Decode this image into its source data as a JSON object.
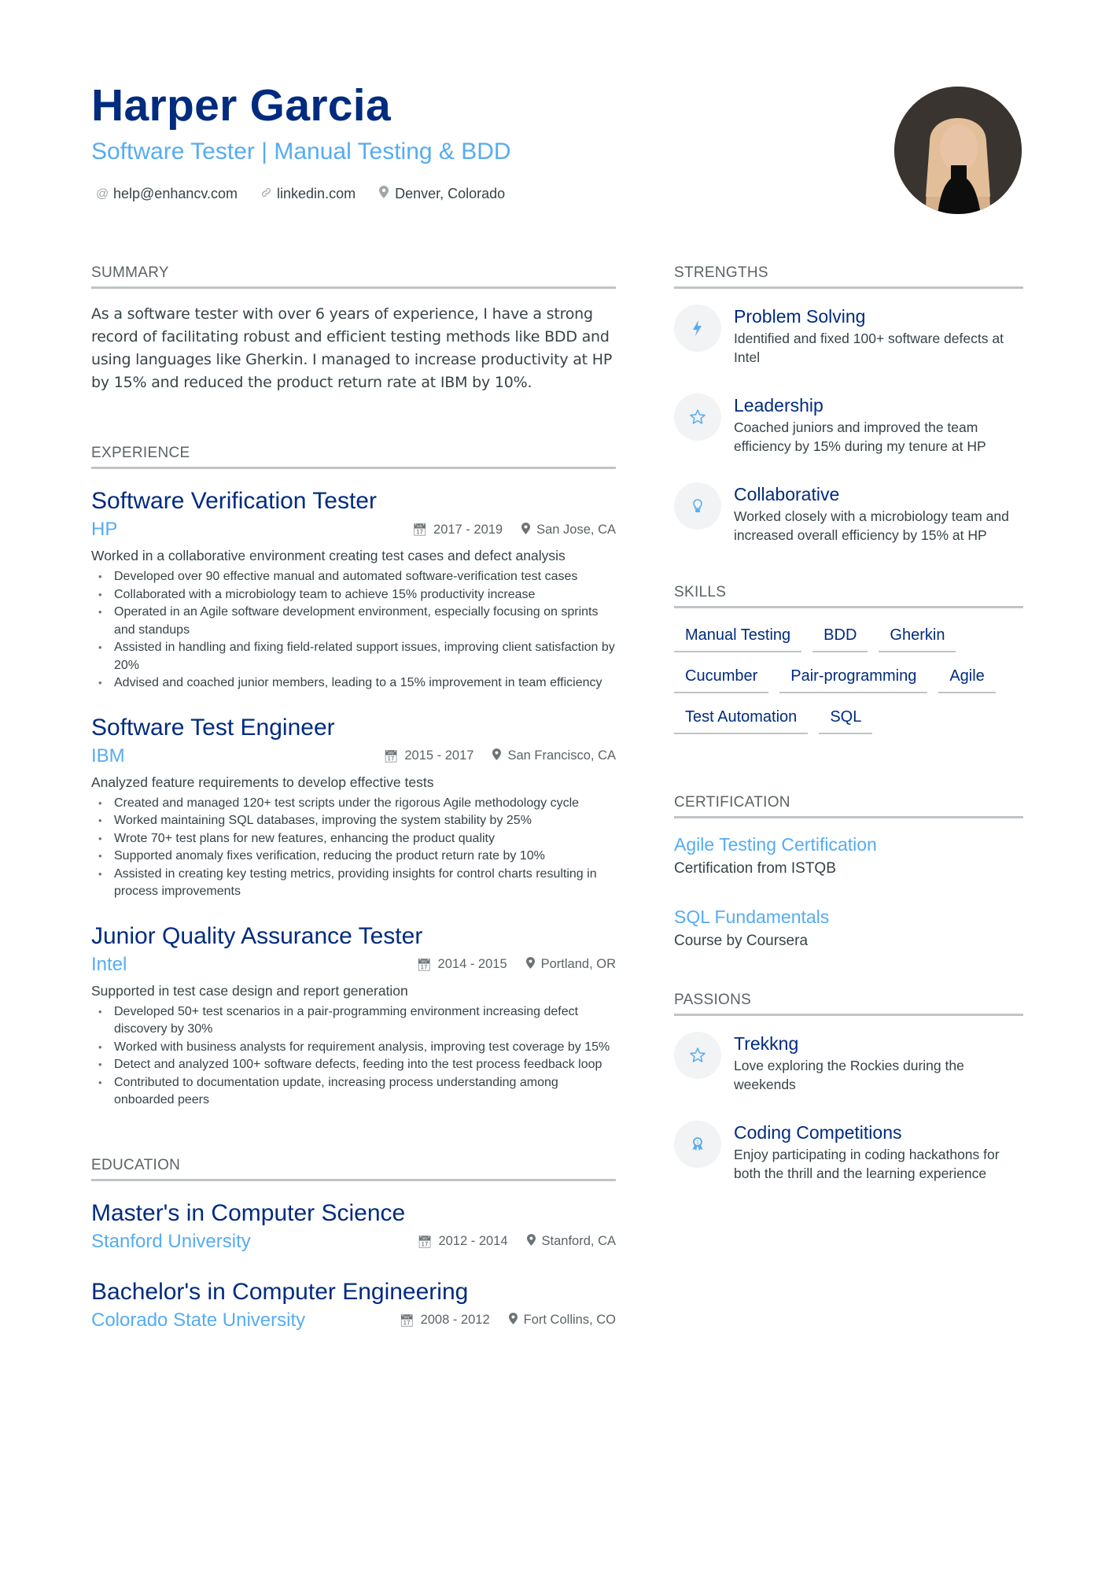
{
  "header": {
    "name": "Harper Garcia",
    "title": "Software Tester | Manual Testing & BDD",
    "contacts": [
      {
        "icon": "at-icon",
        "glyph": "@",
        "text": "help@enhancv.com"
      },
      {
        "icon": "link-icon",
        "glyph": "🔗",
        "text": "linkedin.com"
      },
      {
        "icon": "location-pin-icon",
        "glyph": "⚲",
        "text": "Denver, Colorado"
      }
    ]
  },
  "colors": {
    "primary": "#002b7f",
    "accent": "#56acf2",
    "text": "#384347",
    "muted": "#5c6366",
    "divider": "#c0c4c6"
  },
  "summary": {
    "heading": "SUMMARY",
    "text": "As a software tester with over 6 years of experience, I have a strong record of facilitating robust and efficient testing methods like BDD and using languages like Gherkin. I managed to increase productivity at HP by 15% and reduced the product return rate at IBM by 10%."
  },
  "experience": {
    "heading": "EXPERIENCE",
    "items": [
      {
        "title": "Software Verification Tester",
        "company": "HP",
        "dates": "2017 - 2019",
        "location": "San Jose, CA",
        "description": "Worked in a collaborative environment creating test cases and defect analysis",
        "bullets": [
          "Developed over 90 effective manual and automated software-verification test cases",
          "Collaborated with a microbiology team to achieve 15% productivity increase",
          "Operated in an Agile software development environment, especially focusing on sprints and standups",
          "Assisted in handling and fixing field-related support issues, improving client satisfaction by 20%",
          "Advised and coached junior members, leading to a 15% improvement in team efficiency"
        ]
      },
      {
        "title": "Software Test Engineer",
        "company": "IBM",
        "dates": "2015 - 2017",
        "location": "San Francisco, CA",
        "description": "Analyzed feature requirements to develop effective tests",
        "bullets": [
          "Created and managed 120+ test scripts under the rigorous Agile methodology cycle",
          "Worked maintaining SQL databases, improving the system stability by 25%",
          "Wrote 70+ test plans for new features, enhancing the product quality",
          "Supported anomaly fixes verification, reducing the product return rate by 10%",
          "Assisted in creating key testing metrics, providing insights for control charts resulting in process improvements"
        ]
      },
      {
        "title": "Junior Quality Assurance Tester",
        "company": "Intel",
        "dates": "2014 - 2015",
        "location": "Portland, OR",
        "description": "Supported in test case design and report generation",
        "bullets": [
          "Developed 50+ test scenarios in a pair-programming environment increasing defect discovery by 30%",
          "Worked with business analysts for requirement analysis, improving test coverage by 15%",
          "Detect and analyzed 100+ software defects, feeding into the test process feedback loop",
          "Contributed to documentation update, increasing process understanding among onboarded peers"
        ]
      }
    ]
  },
  "education": {
    "heading": "EDUCATION",
    "items": [
      {
        "degree": "Master's in Computer Science",
        "school": "Stanford University",
        "dates": "2012 - 2014",
        "location": "Stanford, CA"
      },
      {
        "degree": "Bachelor's in Computer Engineering",
        "school": "Colorado State University",
        "dates": "2008 - 2012",
        "location": "Fort Collins, CO"
      }
    ]
  },
  "strengths": {
    "heading": "STRENGTHS",
    "items": [
      {
        "icon": "lightning-bolt-icon",
        "title": "Problem Solving",
        "description": "Identified and fixed 100+ software defects at Intel"
      },
      {
        "icon": "star-icon",
        "title": "Leadership",
        "description": "Coached juniors and improved the team efficiency by 15% during my tenure at HP"
      },
      {
        "icon": "lightbulb-icon",
        "title": "Collaborative",
        "description": "Worked closely with a microbiology team and increased overall efficiency by 15% at HP"
      }
    ]
  },
  "skills": {
    "heading": "SKILLS",
    "items": [
      "Manual Testing",
      "BDD",
      "Gherkin",
      "Cucumber",
      "Pair-programming",
      "Agile",
      "Test Automation",
      "SQL"
    ]
  },
  "certification": {
    "heading": "CERTIFICATION",
    "items": [
      {
        "title": "Agile Testing Certification",
        "description": "Certification from ISTQB"
      },
      {
        "title": "SQL Fundamentals",
        "description": "Course by Coursera"
      }
    ]
  },
  "passions": {
    "heading": "PASSIONS",
    "items": [
      {
        "icon": "star-icon",
        "title": "Trekkng",
        "description": "Love exploring the Rockies during the weekends"
      },
      {
        "icon": "award-medal-icon",
        "title": "Coding Competitions",
        "description": "Enjoy participating in coding hackathons for both the thrill and the learning experience"
      }
    ]
  }
}
